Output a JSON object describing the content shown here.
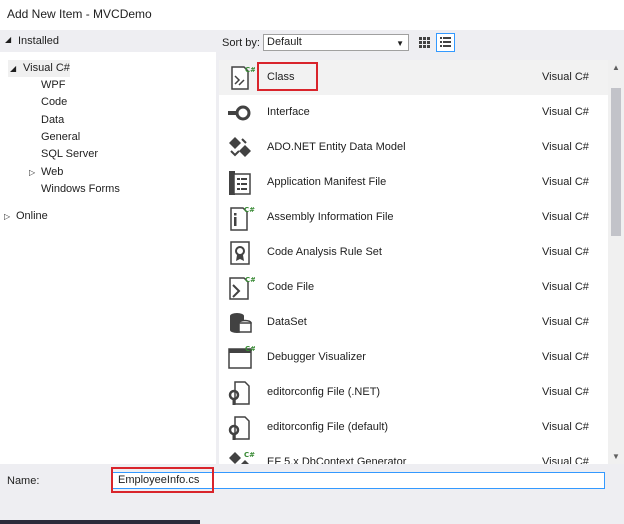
{
  "window": {
    "title": "Add New Item - MVCDemo"
  },
  "sidebar": {
    "installed_label": "Installed",
    "tree": [
      {
        "label": "Visual C#",
        "expanded": true,
        "selected": true
      },
      {
        "label": "WPF"
      },
      {
        "label": "Code"
      },
      {
        "label": "Data"
      },
      {
        "label": "General"
      },
      {
        "label": "SQL Server"
      },
      {
        "label": "Web",
        "collapsed": true
      },
      {
        "label": "Windows Forms"
      }
    ],
    "online_label": "Online"
  },
  "toolbar": {
    "sort_label": "Sort by:",
    "sort_value": "Default"
  },
  "templates": [
    {
      "name": "Class",
      "language": "Visual C#",
      "icon": "class-icon"
    },
    {
      "name": "Interface",
      "language": "Visual C#",
      "icon": "interface-icon"
    },
    {
      "name": "ADO.NET Entity Data Model",
      "language": "Visual C#",
      "icon": "entity-model-icon"
    },
    {
      "name": "Application Manifest File",
      "language": "Visual C#",
      "icon": "manifest-icon"
    },
    {
      "name": "Assembly Information File",
      "language": "Visual C#",
      "icon": "assembly-info-icon"
    },
    {
      "name": "Code Analysis Rule Set",
      "language": "Visual C#",
      "icon": "rule-set-icon"
    },
    {
      "name": "Code File",
      "language": "Visual C#",
      "icon": "code-file-icon"
    },
    {
      "name": "DataSet",
      "language": "Visual C#",
      "icon": "dataset-icon"
    },
    {
      "name": "Debugger Visualizer",
      "language": "Visual C#",
      "icon": "debugger-visualizer-icon"
    },
    {
      "name": "editorconfig File (.NET)",
      "language": "Visual C#",
      "icon": "editorconfig-icon"
    },
    {
      "name": "editorconfig File (default)",
      "language": "Visual C#",
      "icon": "editorconfig-icon"
    },
    {
      "name": "EF 5.x DbContext Generator",
      "language": "Visual C#",
      "icon": "ef-generator-icon"
    }
  ],
  "name_field": {
    "label": "Name:",
    "value": "EmployeeInfo.cs"
  },
  "colors": {
    "accent": "#3399ff",
    "highlight_box": "#d9242b",
    "icon_dark": "#424242",
    "cs_badge_green": "#388a34"
  }
}
